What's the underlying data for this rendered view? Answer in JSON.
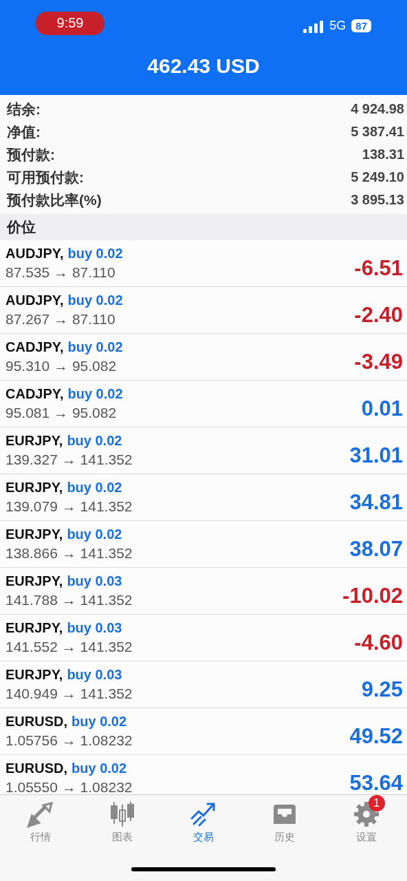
{
  "status_bar": {
    "time": "9:59",
    "network": "5G",
    "battery": "87"
  },
  "header": {
    "title": "462.43 USD"
  },
  "summary": [
    {
      "label": "结余:",
      "value": "4 924.98"
    },
    {
      "label": "净值:",
      "value": "5 387.41"
    },
    {
      "label": "预付款:",
      "value": "138.31"
    },
    {
      "label": "可用预付款:",
      "value": "5 249.10"
    },
    {
      "label": "预付款比率(%)",
      "value": "3 895.13"
    }
  ],
  "section": {
    "title": "价位"
  },
  "positions": [
    {
      "symbol": "AUDJPY,",
      "order": "buy 0.02",
      "prices": "87.535 → 87.110",
      "profit": "-6.51",
      "color": "#c8202a"
    },
    {
      "symbol": "AUDJPY,",
      "order": "buy 0.02",
      "prices": "87.267 → 87.110",
      "profit": "-2.40",
      "color": "#c8202a"
    },
    {
      "symbol": "CADJPY,",
      "order": "buy 0.02",
      "prices": "95.310 → 95.082",
      "profit": "-3.49",
      "color": "#c8202a"
    },
    {
      "symbol": "CADJPY,",
      "order": "buy 0.02",
      "prices": "95.081 → 95.082",
      "profit": "0.01",
      "color": "#1a6fdc"
    },
    {
      "symbol": "EURJPY,",
      "order": "buy 0.02",
      "prices": "139.327 → 141.352",
      "profit": "31.01",
      "color": "#1a6fdc"
    },
    {
      "symbol": "EURJPY,",
      "order": "buy 0.02",
      "prices": "139.079 → 141.352",
      "profit": "34.81",
      "color": "#1a6fdc"
    },
    {
      "symbol": "EURJPY,",
      "order": "buy 0.02",
      "prices": "138.866 → 141.352",
      "profit": "38.07",
      "color": "#1a6fdc"
    },
    {
      "symbol": "EURJPY,",
      "order": "buy 0.03",
      "prices": "141.788 → 141.352",
      "profit": "-10.02",
      "color": "#c8202a"
    },
    {
      "symbol": "EURJPY,",
      "order": "buy 0.03",
      "prices": "141.552 → 141.352",
      "profit": "-4.60",
      "color": "#c8202a"
    },
    {
      "symbol": "EURJPY,",
      "order": "buy 0.03",
      "prices": "140.949 → 141.352",
      "profit": "9.25",
      "color": "#1a6fdc"
    },
    {
      "symbol": "EURUSD,",
      "order": "buy 0.02",
      "prices": "1.05756 → 1.08232",
      "profit": "49.52",
      "color": "#1a6fdc"
    },
    {
      "symbol": "EURUSD,",
      "order": "buy 0.02",
      "prices": "1.05550 → 1.08232",
      "profit": "53.64",
      "color": "#1a6fdc"
    }
  ],
  "tab_bar": [
    {
      "kind": "quotes",
      "label": "行情",
      "selected": false
    },
    {
      "kind": "chart",
      "label": "图表",
      "selected": false
    },
    {
      "kind": "trade",
      "label": "交易",
      "selected": true
    },
    {
      "kind": "history",
      "label": "历史",
      "selected": false
    },
    {
      "kind": "settings",
      "label": "设置",
      "selected": false,
      "badge": "1"
    }
  ]
}
